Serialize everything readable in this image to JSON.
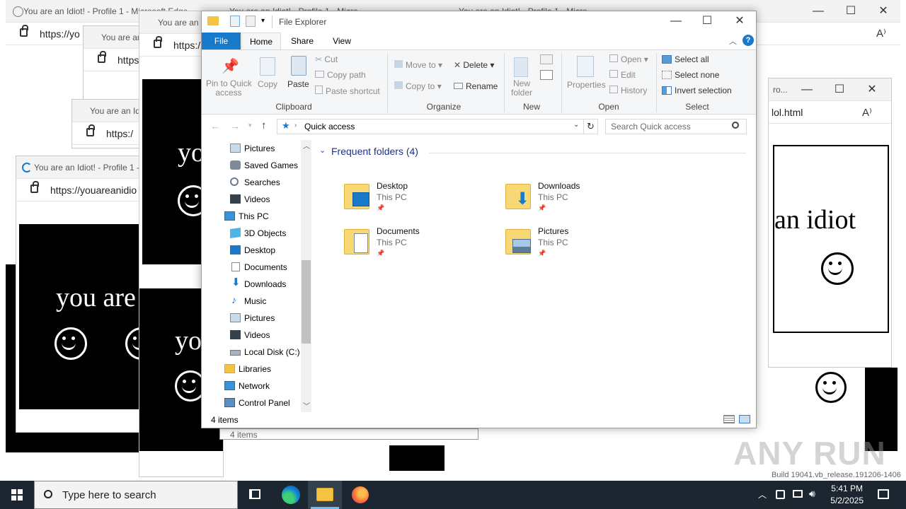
{
  "background_windows": {
    "edge_title_1": "You are an Idiot! - Profile 1 - Microsoft Edge",
    "edge_title_2": "You are an Idiot! - Profile 1 - Micro",
    "edge_title_3": "You are an Idiot! - Profile 1 - Micro",
    "edge_title_4": "You are an Idio",
    "edge_title_5": "You are an Idiot! - Profile 1 -",
    "edge_title_6": "You are an Idiot! - Profile 1 -",
    "edge_title_7": "You are an I",
    "url_short": "https://yo",
    "url_short_2": "https://",
    "url_short_3": "https:/",
    "url_long": "https://youareanidio",
    "url_idiot": "lol.html",
    "tab_fragment": "ro...",
    "idiot_phrase_1": "you are",
    "idiot_phrase_2": "yo",
    "idiot_phrase_3": "yo",
    "idiot_phrase_4": "an idiot",
    "status_fragment": "4 items",
    "build_text": "Build 19041.vb_release.191206-1406",
    "watermark": "ANY RUN"
  },
  "explorer": {
    "title": "File Explorer",
    "tabs": [
      "File",
      "Home",
      "Share",
      "View"
    ],
    "ribbon": {
      "clipboard": {
        "label": "Clipboard",
        "pin": "Pin to Quick access",
        "pin_line1": "Pin to Quick",
        "pin_line2": "access",
        "copy": "Copy",
        "paste": "Paste",
        "cut": "Cut",
        "copy_path": "Copy path",
        "paste_shortcut": "Paste shortcut"
      },
      "organize": {
        "label": "Organize",
        "move_to": "Move to",
        "copy_to": "Copy to",
        "delete": "Delete",
        "rename": "Rename"
      },
      "new": {
        "label": "New",
        "new_folder_line1": "New",
        "new_folder_line2": "folder"
      },
      "open": {
        "label": "Open",
        "properties": "Properties",
        "open": "Open",
        "edit": "Edit",
        "history": "History"
      },
      "select": {
        "label": "Select",
        "select_all": "Select all",
        "select_none": "Select none",
        "invert": "Invert selection"
      }
    },
    "address": {
      "location": "Quick access",
      "search_placeholder": "Search Quick access"
    },
    "nav_items": [
      {
        "label": "Pictures",
        "icon": "pictures-icon"
      },
      {
        "label": "Saved Games",
        "icon": "saved-games-icon"
      },
      {
        "label": "Searches",
        "icon": "searches-icon"
      },
      {
        "label": "Videos",
        "icon": "videos-icon"
      },
      {
        "label": "This PC",
        "icon": "this-pc-icon"
      },
      {
        "label": "3D Objects",
        "icon": "3d-objects-icon"
      },
      {
        "label": "Desktop",
        "icon": "desktop-icon"
      },
      {
        "label": "Documents",
        "icon": "documents-icon"
      },
      {
        "label": "Downloads",
        "icon": "downloads-icon"
      },
      {
        "label": "Music",
        "icon": "music-icon"
      },
      {
        "label": "Pictures",
        "icon": "pictures-icon"
      },
      {
        "label": "Videos",
        "icon": "videos-icon"
      },
      {
        "label": "Local Disk (C:)",
        "icon": "local-disk-icon"
      },
      {
        "label": "Libraries",
        "icon": "libraries-icon"
      },
      {
        "label": "Network",
        "icon": "network-icon"
      },
      {
        "label": "Control Panel",
        "icon": "control-panel-icon"
      }
    ],
    "section_title": "Frequent folders (4)",
    "folders": [
      {
        "name": "Desktop",
        "location": "This PC",
        "icon": "desktop-folder-icon"
      },
      {
        "name": "Downloads",
        "location": "This PC",
        "icon": "downloads-folder-icon"
      },
      {
        "name": "Documents",
        "location": "This PC",
        "icon": "documents-folder-icon"
      },
      {
        "name": "Pictures",
        "location": "This PC",
        "icon": "pictures-folder-icon"
      }
    ],
    "status": "4 items"
  },
  "taskbar": {
    "search_placeholder": "Type here to search",
    "time": "5:41 PM",
    "date": "5/2/2025"
  },
  "colors": {
    "accent": "#1979ca",
    "taskbar": "#1c2631",
    "ribbon": "#f5f6f7"
  }
}
